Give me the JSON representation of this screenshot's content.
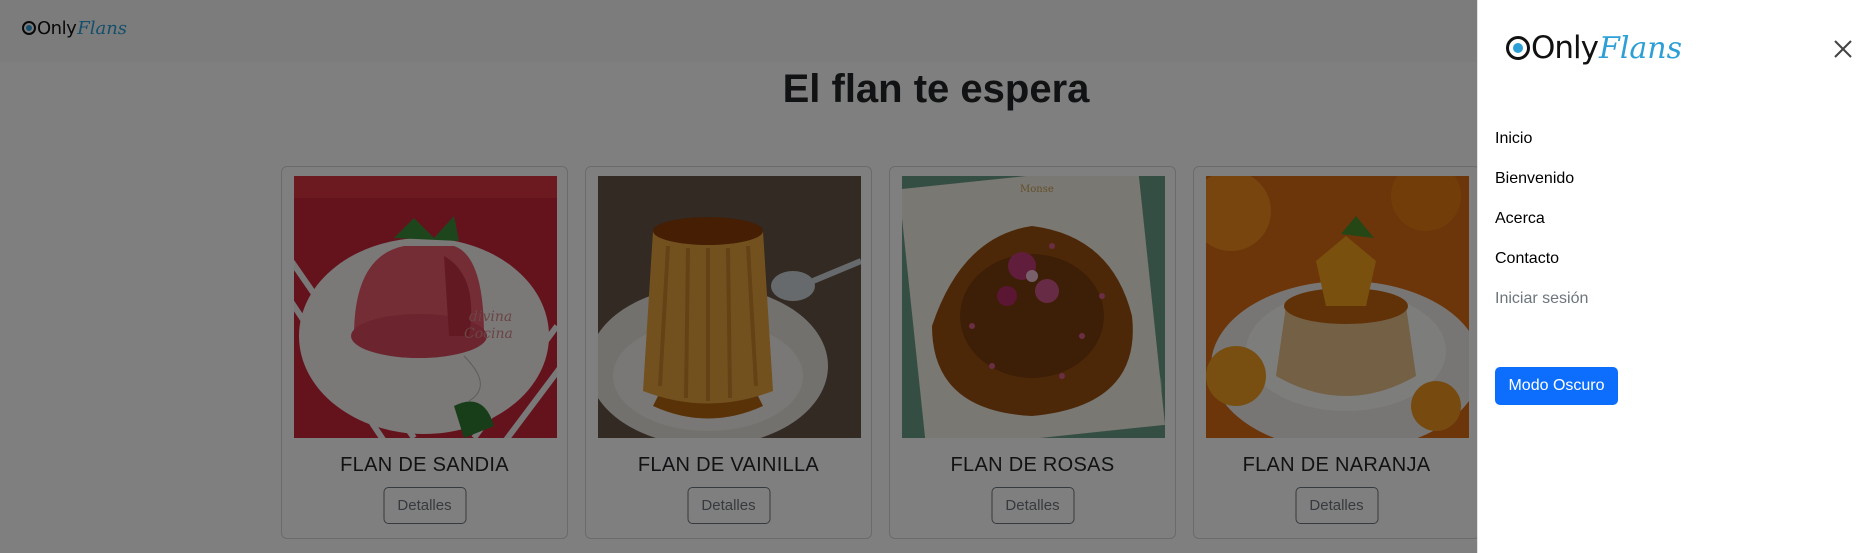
{
  "brand": {
    "only": "Only",
    "flans": "Flans"
  },
  "hero": {
    "title": "El flan te espera"
  },
  "cards": [
    {
      "title": "FLAN DE SANDIA",
      "button": "Detalles"
    },
    {
      "title": "FLAN DE VAINILLA",
      "button": "Detalles"
    },
    {
      "title": "FLAN DE ROSAS",
      "button": "Detalles"
    },
    {
      "title": "FLAN DE NARANJA",
      "button": "Detalles"
    }
  ],
  "offcanvas": {
    "links": [
      "Inicio",
      "Bienvenido",
      "Acerca",
      "Contacto",
      "Iniciar sesión"
    ],
    "dark_mode_button": "Modo Oscuro",
    "close_icon": "close-icon"
  },
  "colors": {
    "accent": "#0d6efd",
    "brand_blue": "#2b9fd6",
    "backdrop": "rgba(0,0,0,0.5)"
  }
}
